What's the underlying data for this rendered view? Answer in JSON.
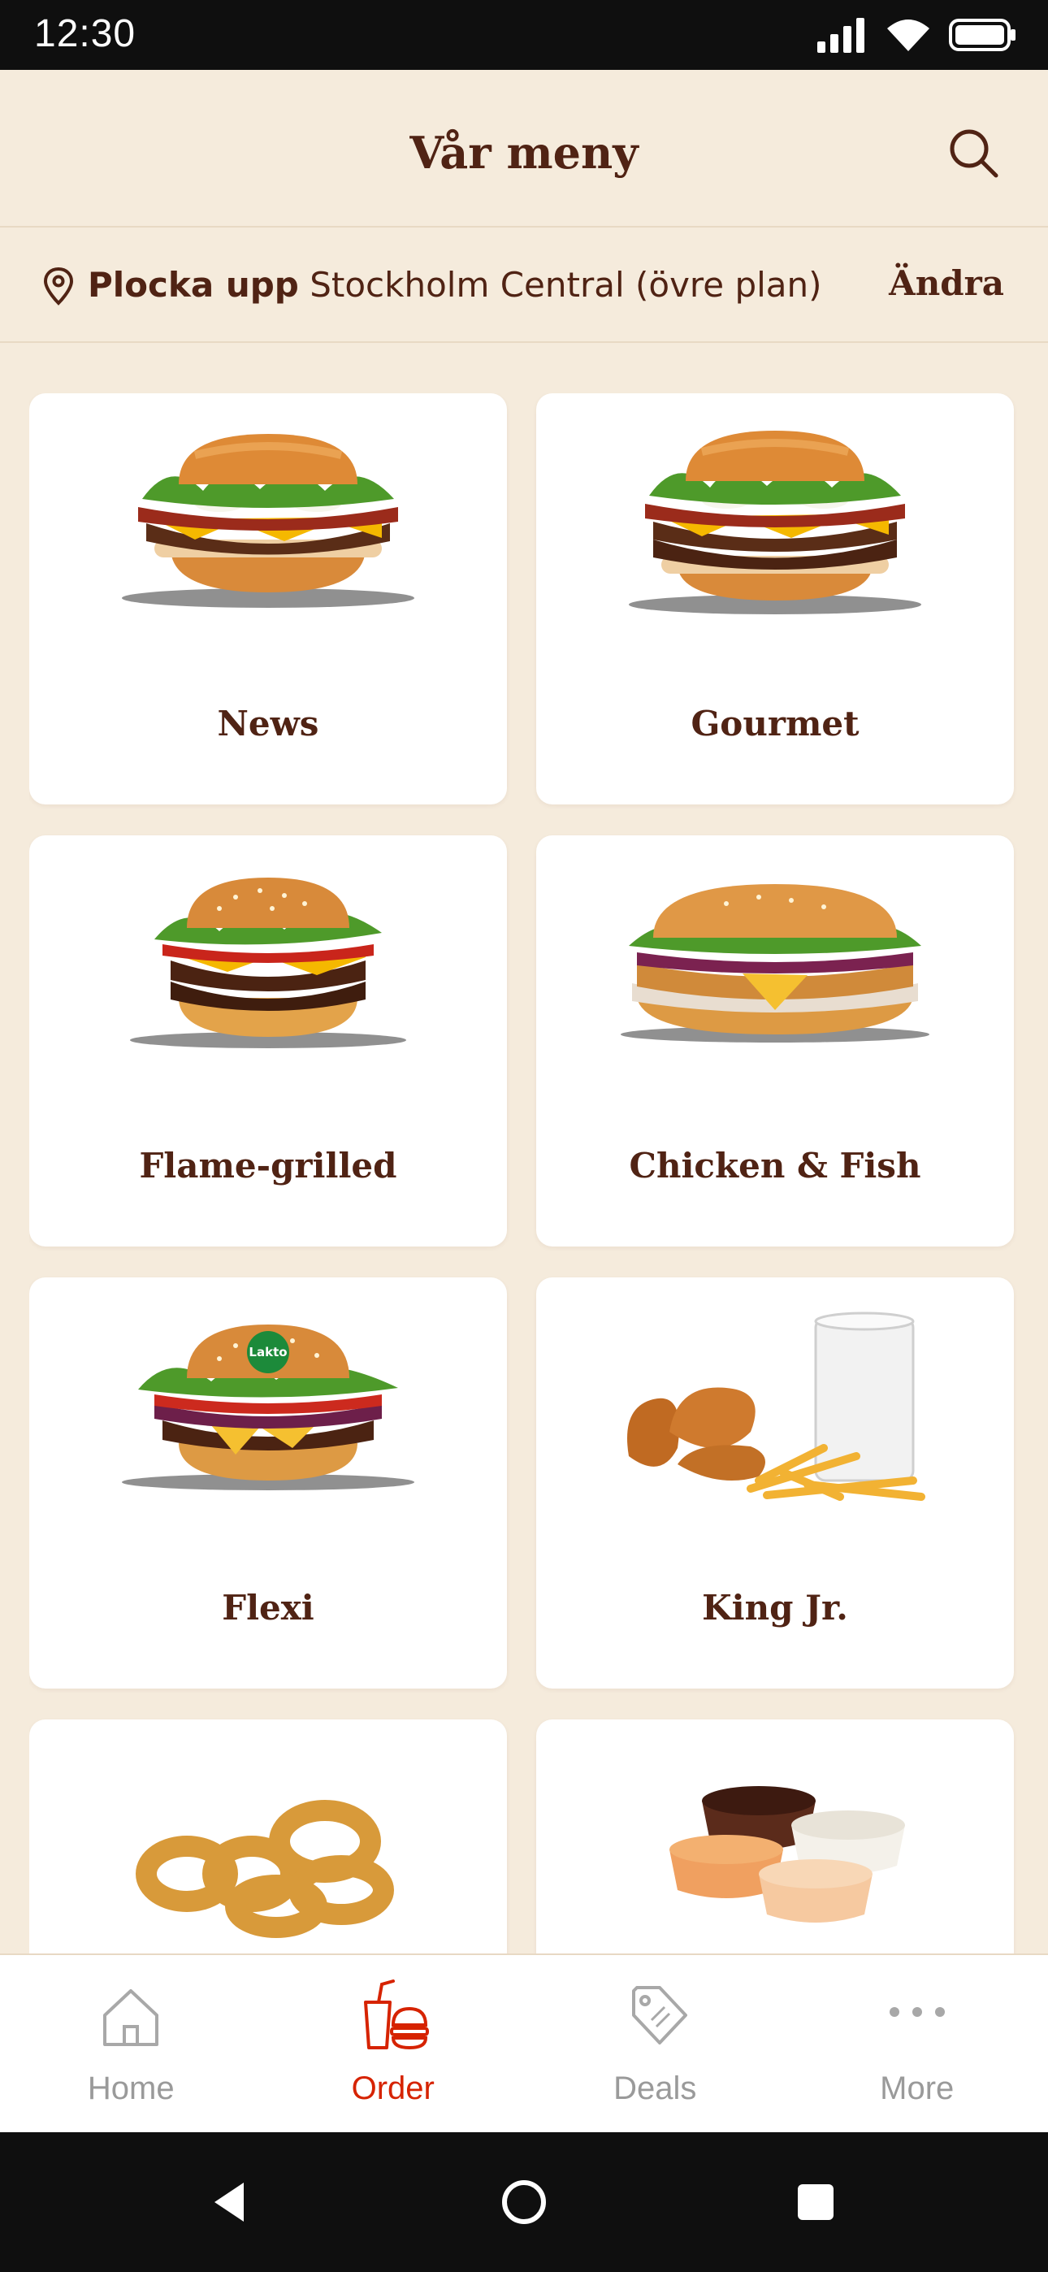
{
  "status_bar": {
    "time": "12:30"
  },
  "header": {
    "title": "Vår meny"
  },
  "location": {
    "mode": "Plocka upp",
    "restaurant": "Stockholm Central (övre plan)",
    "change_label": "Ändra"
  },
  "categories": [
    {
      "label": "News",
      "image": "burger-bacon"
    },
    {
      "label": "Gourmet",
      "image": "burger-bacon-double"
    },
    {
      "label": "Flame-grilled",
      "image": "burger-double-sesame"
    },
    {
      "label": "Chicken & Fish",
      "image": "chicken-long-sandwich"
    },
    {
      "label": "Flexi",
      "image": "burger-plant-lakto",
      "badge": "Lakto"
    },
    {
      "label": "King Jr.",
      "image": "kids-nuggets-fries-milk"
    },
    {
      "label": "",
      "image": "onion-rings"
    },
    {
      "label": "",
      "image": "dip-sauces"
    }
  ],
  "bottom_nav": {
    "items": [
      {
        "label": "Home",
        "icon": "home-icon",
        "active": false
      },
      {
        "label": "Order",
        "icon": "order-icon",
        "active": true
      },
      {
        "label": "Deals",
        "icon": "deals-tag-icon",
        "active": false
      },
      {
        "label": "More",
        "icon": "more-dots-icon",
        "active": false
      }
    ]
  },
  "colors": {
    "background": "#f5ebdc",
    "brand_brown": "#502314",
    "accent_red": "#d62300",
    "inactive_gray": "#9a9a9a",
    "badge_green": "#1c8a3a"
  }
}
